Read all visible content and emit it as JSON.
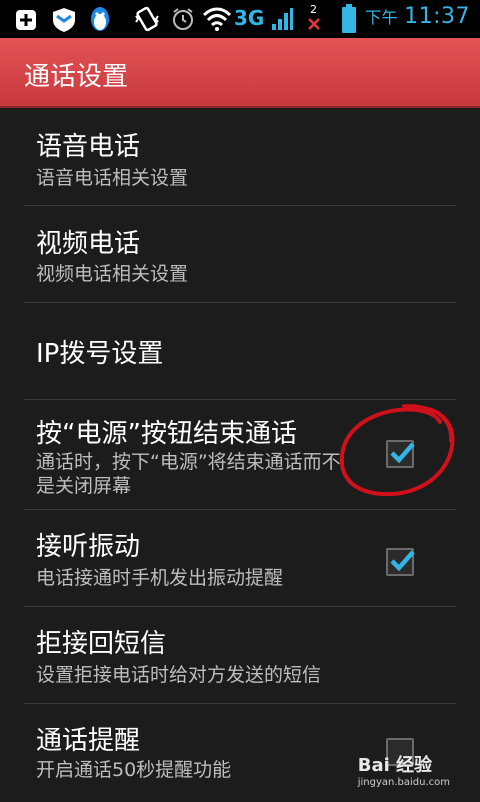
{
  "status_bar": {
    "network": "3G",
    "sim_badge": "2",
    "ampm": "下午",
    "time": "11:37"
  },
  "header": {
    "title": "通话设置"
  },
  "settings": [
    {
      "label": "语音电话",
      "summary": "语音电话相关设置"
    },
    {
      "label": "视频电话",
      "summary": "视频电话相关设置"
    },
    {
      "label": "IP拨号设置"
    },
    {
      "label": "按“电源”按钮结束通话",
      "summary": "通话时，按下“电源”将结束通话而不是关闭屏幕",
      "checked": true
    },
    {
      "label": "接听振动",
      "summary": "电话接通时手机发出振动提醒",
      "checked": true
    },
    {
      "label": "拒接回短信",
      "summary": "设置拒接电话时给对方发送的短信"
    },
    {
      "label": "通话提醒",
      "summary": "开启通话50秒提醒功能",
      "checked": false
    }
  ],
  "watermark": {
    "brand": "Bai 经验",
    "url": "jingyan.baidu.com"
  },
  "colors": {
    "accent": "#33b5e5",
    "header_red": "#d6454a",
    "annotation": "#d0101a"
  }
}
